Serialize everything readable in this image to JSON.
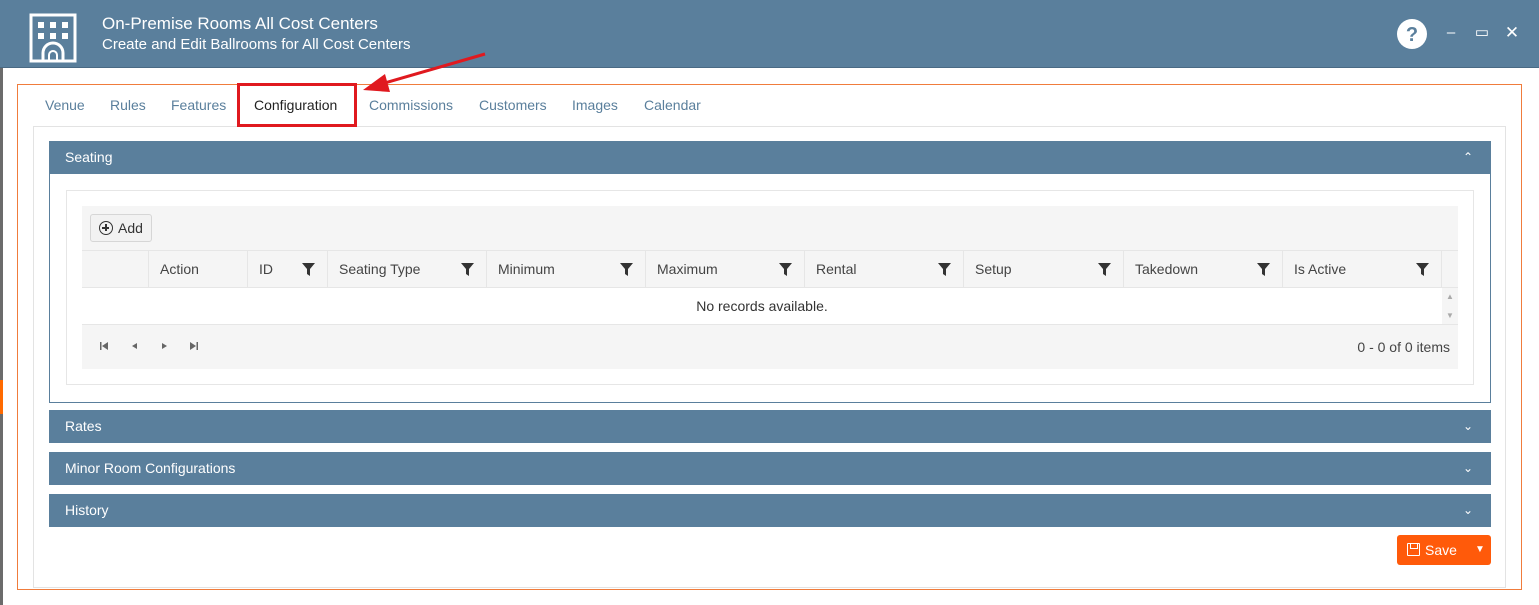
{
  "window": {
    "title": "On-Premise Rooms All Cost Centers",
    "subtitle": "Create and Edit Ballrooms for All Cost Centers",
    "help_icon": "question-mark",
    "minimize_glyph": "–",
    "maximize_glyph": "▭",
    "close_glyph": "✕"
  },
  "tabs": [
    {
      "label": "Venue"
    },
    {
      "label": "Rules"
    },
    {
      "label": "Features"
    },
    {
      "label": "Configuration",
      "active": true
    },
    {
      "label": "Commissions"
    },
    {
      "label": "Customers"
    },
    {
      "label": "Images"
    },
    {
      "label": "Calendar"
    }
  ],
  "seating": {
    "title": "Seating",
    "expanded": true,
    "add_label": "Add",
    "columns": [
      "Action",
      "ID",
      "Seating Type",
      "Minimum",
      "Maximum",
      "Rental",
      "Setup",
      "Takedown",
      "Is Active"
    ],
    "empty_text": "No records available.",
    "pager_info": "0 - 0 of 0 items"
  },
  "sections": {
    "rates": "Rates",
    "minor": "Minor Room Configurations",
    "history": "History"
  },
  "save": {
    "label": "Save"
  },
  "colors": {
    "header_bg": "#5a7f9c",
    "accent": "#ff5a0a",
    "highlight": "#e0191f"
  }
}
